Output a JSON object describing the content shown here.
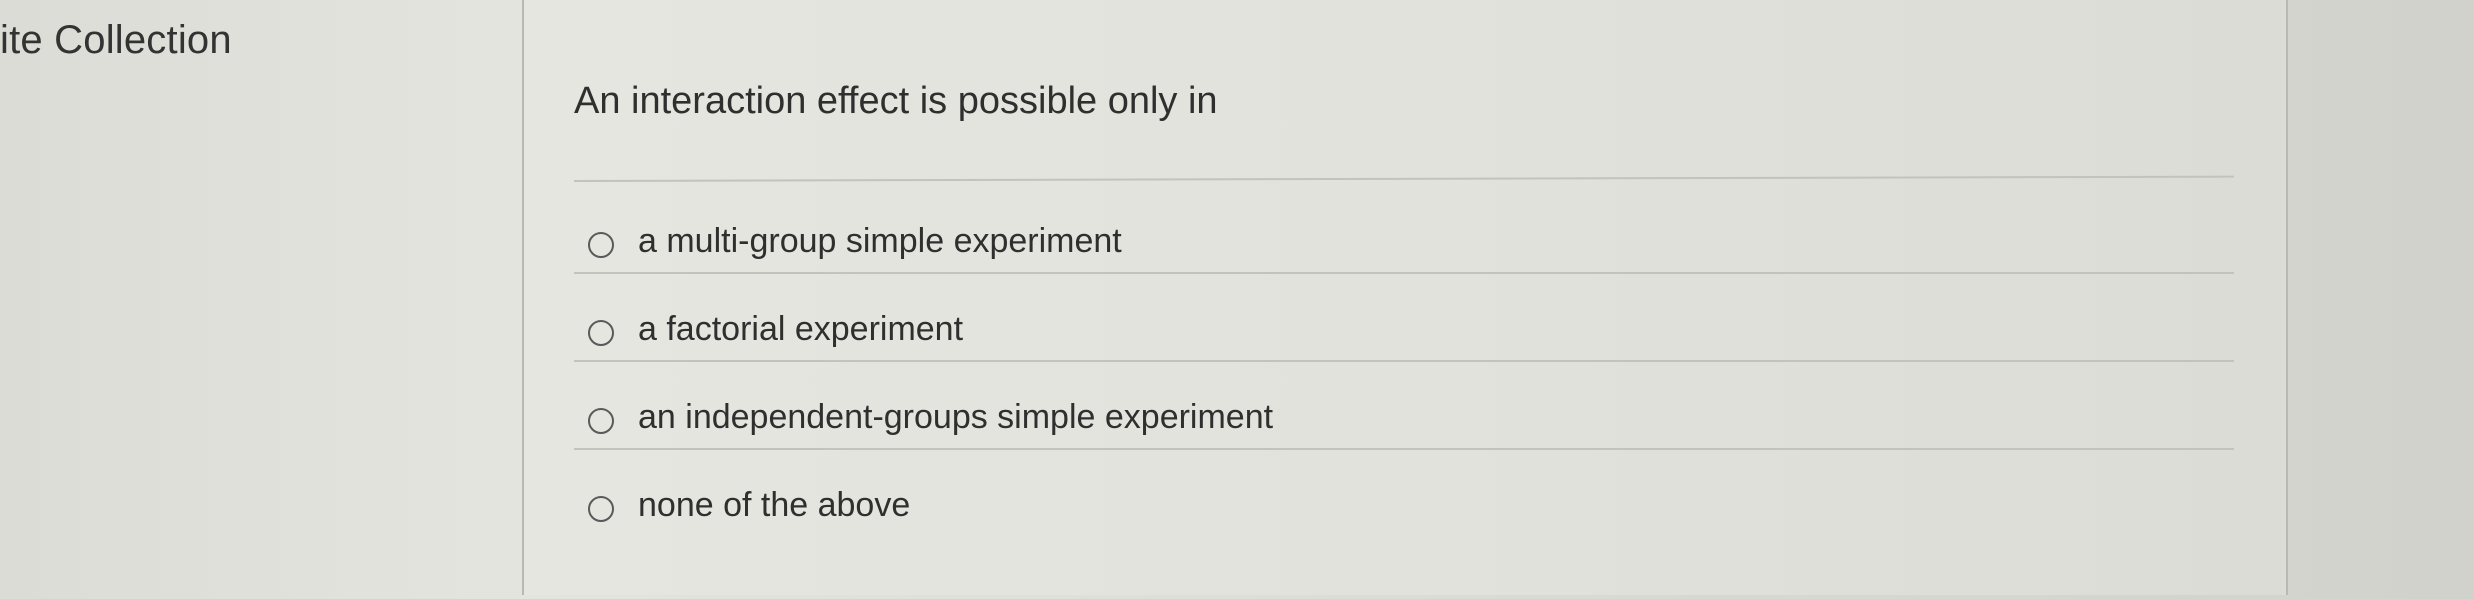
{
  "sidebar": {
    "heading": "ite Collection"
  },
  "question": {
    "prompt": "An interaction effect is possible only in",
    "options": [
      {
        "label": "a multi-group simple experiment",
        "selected": false
      },
      {
        "label": "a factorial experiment",
        "selected": false
      },
      {
        "label": "an independent-groups simple experiment",
        "selected": false
      },
      {
        "label": "none of the above",
        "selected": false
      }
    ]
  }
}
